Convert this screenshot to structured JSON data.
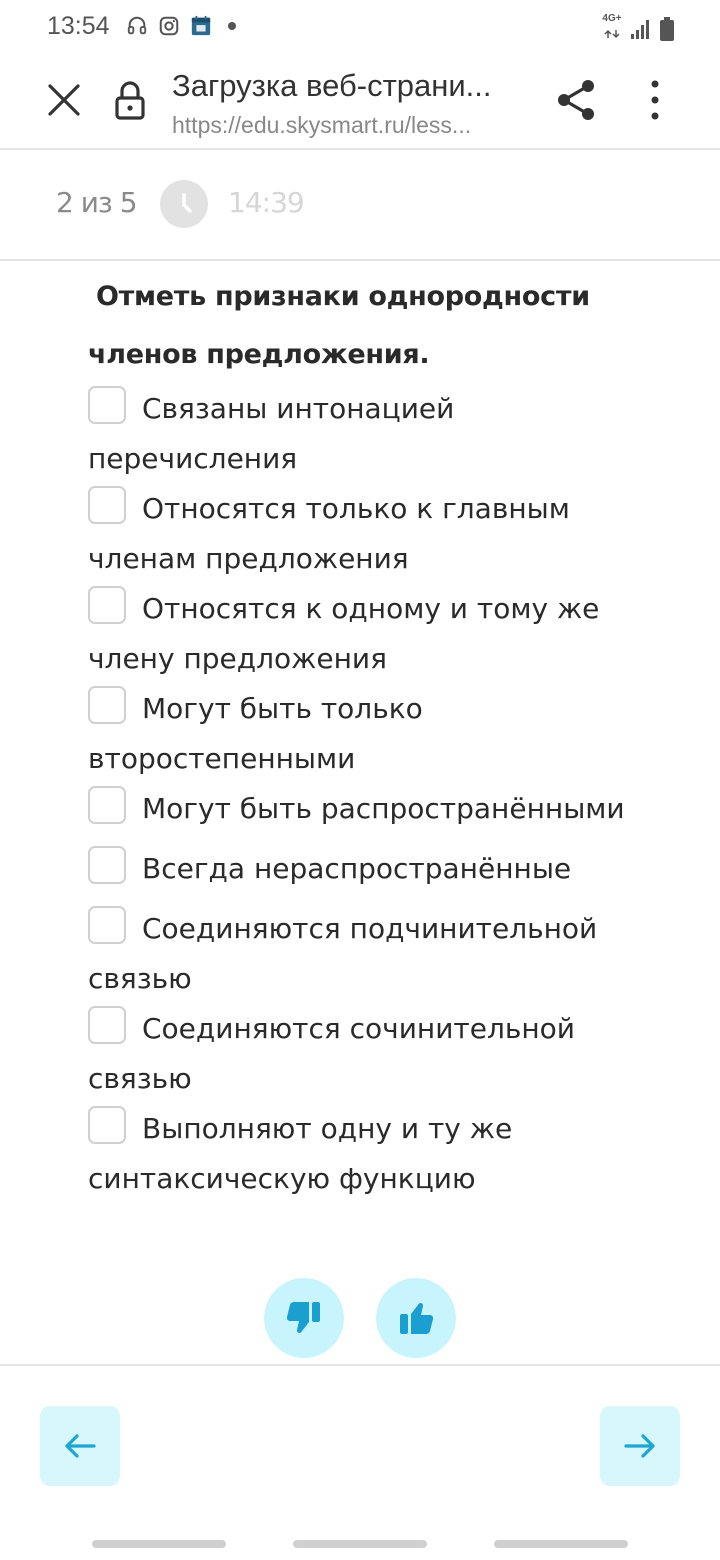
{
  "status_bar": {
    "time": "13:54",
    "left_icons": [
      "headset-icon",
      "instagram-icon",
      "calendar-icon",
      "notification-dot"
    ],
    "network_label": "4G+",
    "right_icons": [
      "signal-icon",
      "battery-icon"
    ]
  },
  "browser": {
    "title": "Загрузка веб-страни...",
    "url": "https://edu.skysmart.ru/less...",
    "close_icon": "close-icon",
    "lock_icon": "lock-icon",
    "share_icon": "share-icon",
    "more_icon": "more-vertical-icon"
  },
  "progress": {
    "counter": "2 из 5",
    "timer": "14:39",
    "clock_icon": "clock-icon"
  },
  "question": {
    "line1": "Отметь признаки однородности",
    "line2": "членов предложения."
  },
  "options": [
    {
      "label": "Связаны интонацией перечисления"
    },
    {
      "label": "Относятся только к главным членам предложения"
    },
    {
      "label": "Относятся к одному и тому же члену предложения"
    },
    {
      "label": "Могут быть только второстепенными"
    },
    {
      "label": "Могут быть распространёнными"
    },
    {
      "label": "Всегда нераспространённые"
    },
    {
      "label": "Соединяются подчинительной связью"
    },
    {
      "label": "Соединяются сочинительной связью"
    },
    {
      "label": "Выполняют одну и ту же синтаксическую функцию"
    }
  ],
  "feedback": {
    "dislike_icon": "thumbs-down-icon",
    "like_icon": "thumbs-up-icon"
  },
  "navigation": {
    "prev_icon": "arrow-left-icon",
    "next_icon": "arrow-right-icon"
  },
  "colors": {
    "accent": "#1ba6d4",
    "button_bg": "#c8f5fd",
    "nav_bg": "#d7f7fc"
  }
}
